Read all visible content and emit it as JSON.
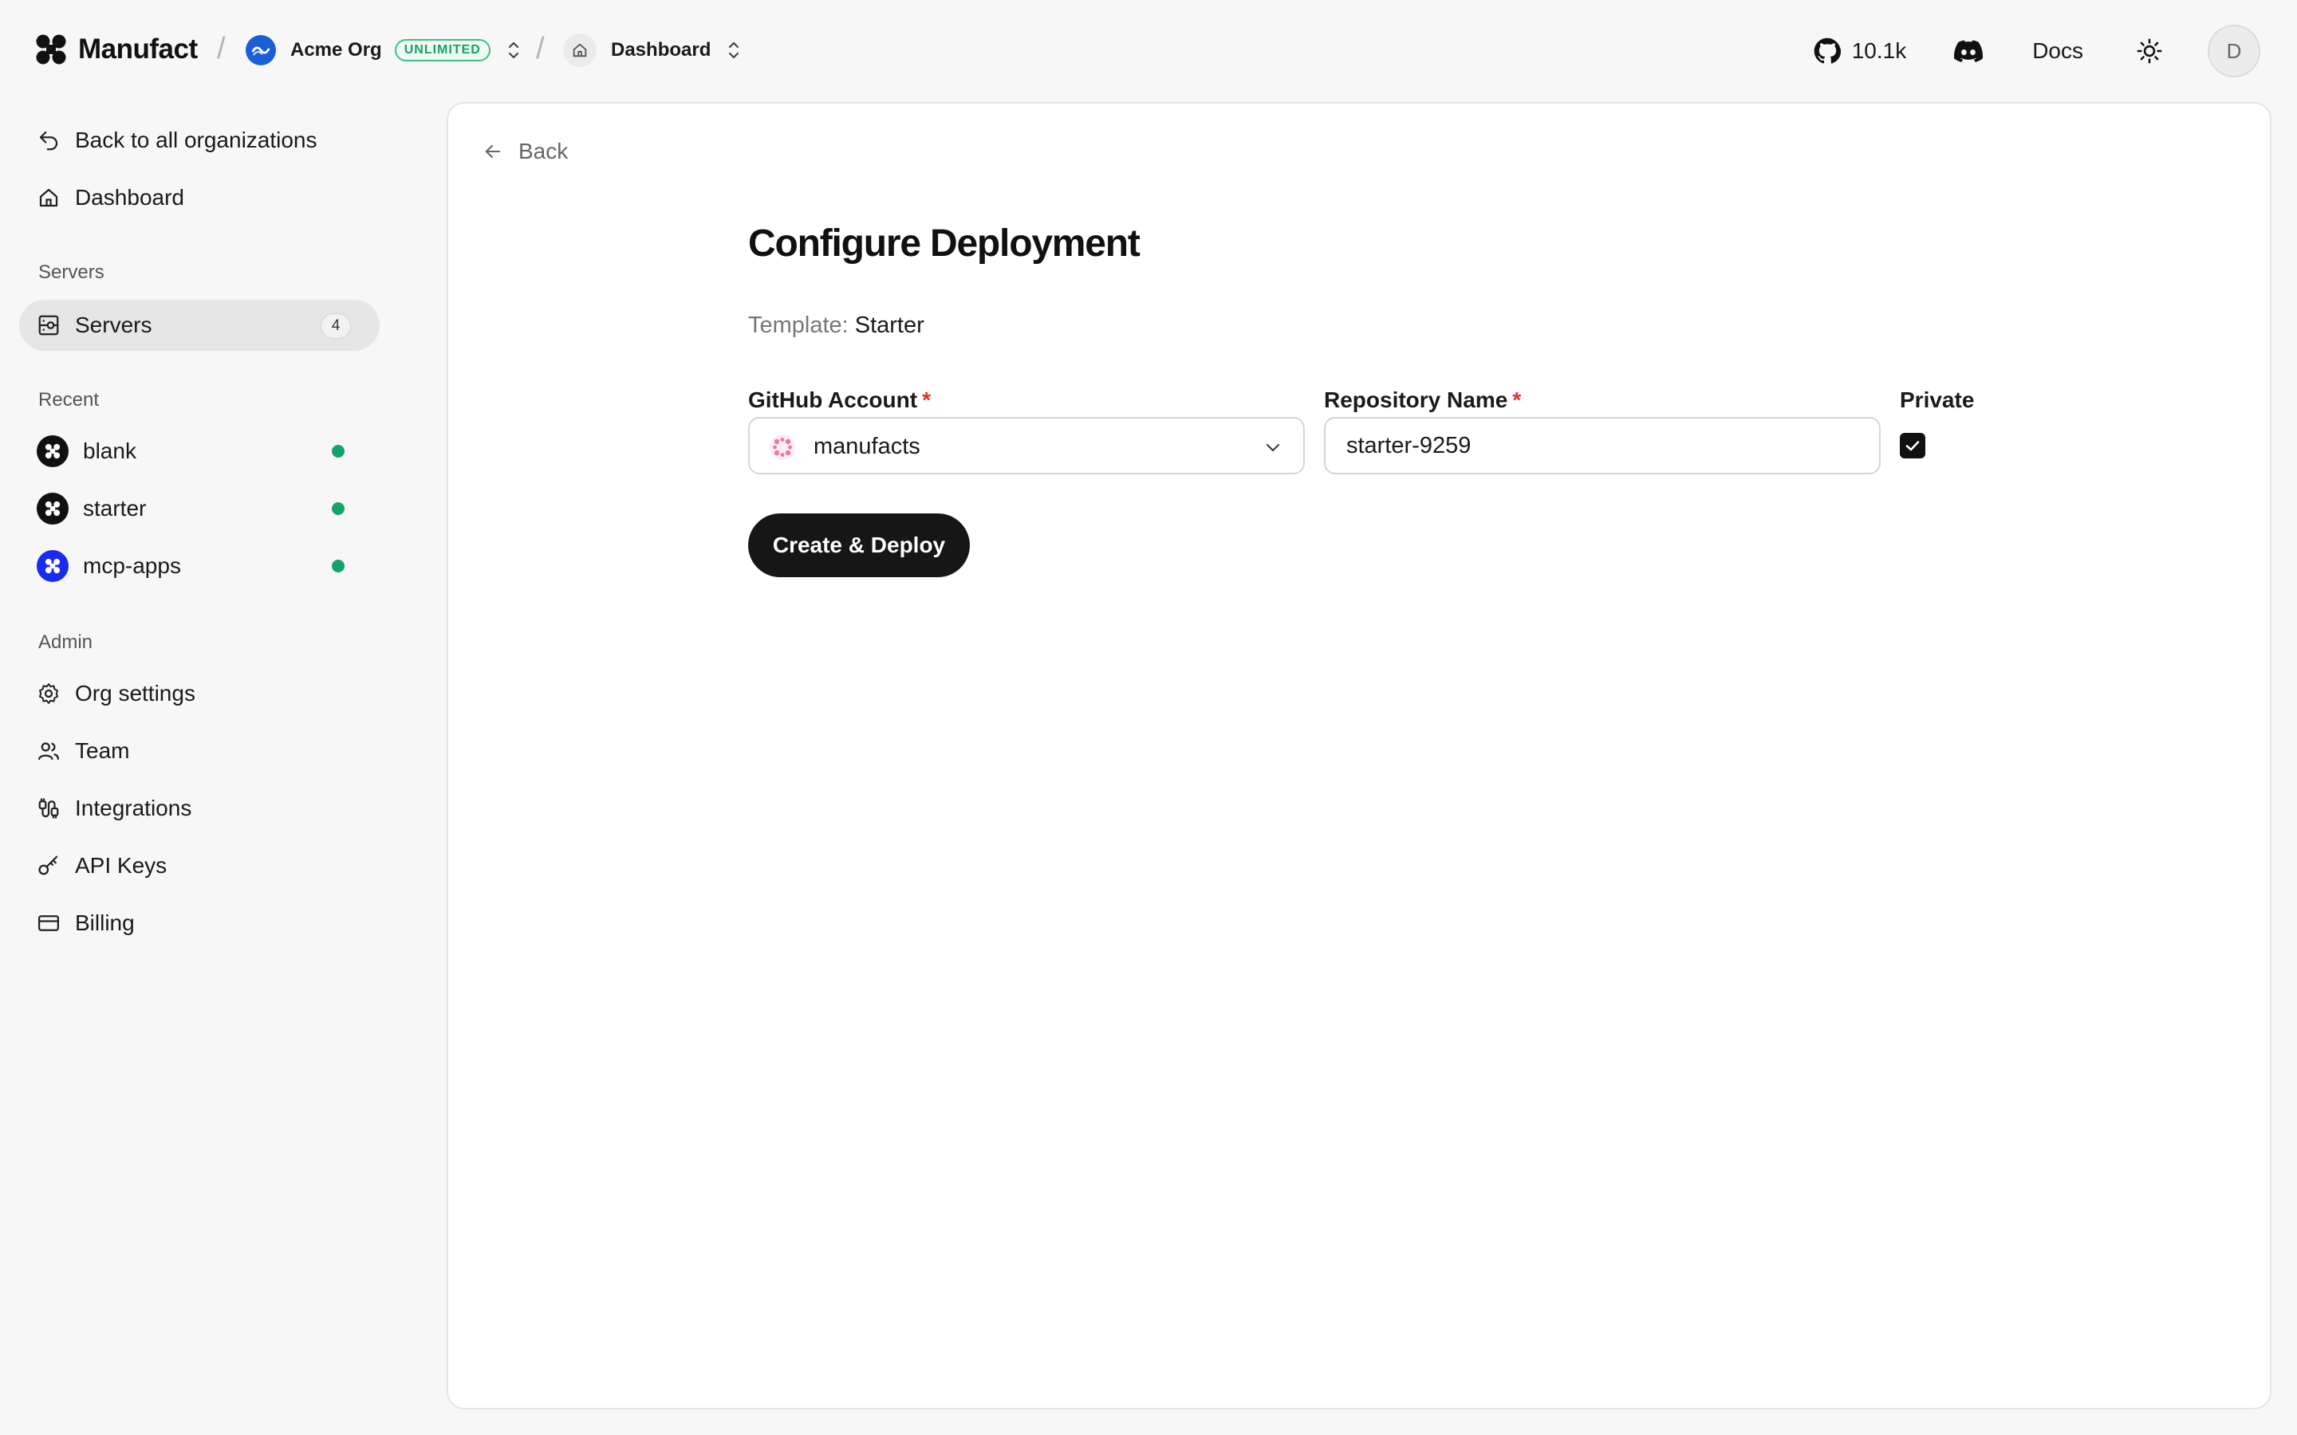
{
  "topbar": {
    "brand": "Manufact",
    "separator": "/",
    "org_name": "Acme Org",
    "org_badge": "UNLIMITED",
    "page_crumb": "Dashboard",
    "github_stars": "10.1k",
    "docs_label": "Docs",
    "user_initial": "D"
  },
  "sidebar": {
    "back_label": "Back to all organizations",
    "dashboard_label": "Dashboard",
    "servers_section": "Servers",
    "servers_item": "Servers",
    "servers_count": "4",
    "recent_section": "Recent",
    "recent": [
      {
        "name": "blank",
        "icon": "manufact-logo-icon",
        "status_color": "#14a36a"
      },
      {
        "name": "starter",
        "icon": "manufact-logo-icon",
        "status_color": "#14a36a"
      },
      {
        "name": "mcp-apps",
        "icon": "manufact-logo-icon",
        "status_color": "#14a36a"
      }
    ],
    "admin_section": "Admin",
    "admin_items": [
      {
        "label": "Org settings",
        "icon": "gear-icon"
      },
      {
        "label": "Team",
        "icon": "users-icon"
      },
      {
        "label": "Integrations",
        "icon": "plug-icon"
      },
      {
        "label": "API Keys",
        "icon": "key-icon"
      },
      {
        "label": "Billing",
        "icon": "credit-card-icon"
      }
    ]
  },
  "main": {
    "back_label": "Back",
    "title": "Configure Deployment",
    "template_label": "Template:",
    "template_value": "Starter",
    "github_account_label": "GitHub Account",
    "required_mark": "*",
    "github_account_value": "manufacts",
    "repo_name_label": "Repository Name",
    "repo_name_value": "starter-9259",
    "private_label": "Private",
    "private_checked": true,
    "deploy_button": "Create & Deploy"
  },
  "colors": {
    "accent_dark": "#161616",
    "status_green": "#14a36a",
    "required_red": "#e0322b",
    "org_blue": "#1a5fd6",
    "mcp_apps_blue": "#1a2bf0"
  }
}
